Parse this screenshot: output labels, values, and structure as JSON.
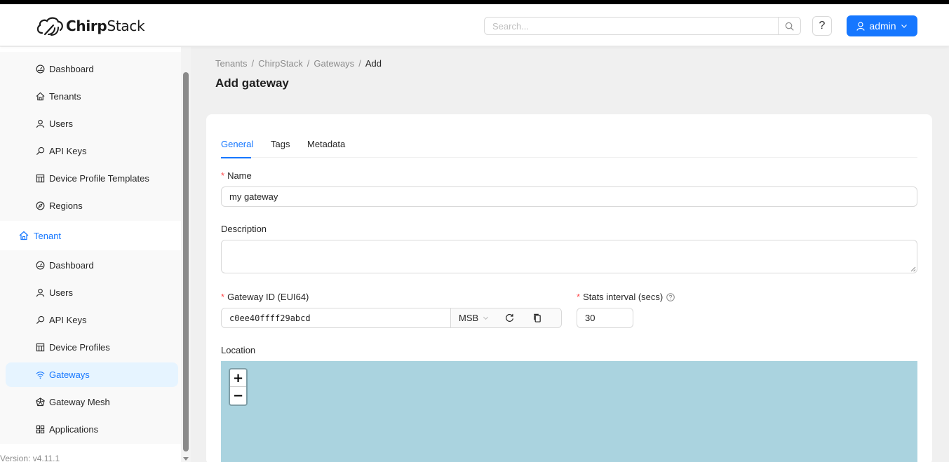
{
  "app": {
    "logo_text_bold": "Chirp",
    "logo_text_regular": "Stack"
  },
  "header": {
    "search_placeholder": "Search...",
    "help_label": "?",
    "user_label": "admin"
  },
  "sidebar": {
    "admin_items": [
      {
        "label": "Dashboard",
        "icon": "dashboard-icon"
      },
      {
        "label": "Tenants",
        "icon": "home-icon"
      },
      {
        "label": "Users",
        "icon": "user-icon"
      },
      {
        "label": "API Keys",
        "icon": "key-icon"
      },
      {
        "label": "Device Profile Templates",
        "icon": "template-icon"
      },
      {
        "label": "Regions",
        "icon": "compass-icon"
      }
    ],
    "tenant_header": "Tenant",
    "tenant_items": [
      {
        "label": "Dashboard",
        "icon": "dashboard-icon"
      },
      {
        "label": "Users",
        "icon": "user-icon"
      },
      {
        "label": "API Keys",
        "icon": "key-icon"
      },
      {
        "label": "Device Profiles",
        "icon": "template-icon"
      },
      {
        "label": "Gateways",
        "icon": "wifi-icon",
        "active": true
      },
      {
        "label": "Gateway Mesh",
        "icon": "mesh-icon"
      },
      {
        "label": "Applications",
        "icon": "apps-icon"
      }
    ],
    "version": "Version: v4.11.1"
  },
  "breadcrumb": {
    "items": [
      "Tenants",
      "ChirpStack",
      "Gateways"
    ],
    "current": "Add",
    "separator": "/"
  },
  "page": {
    "title": "Add gateway"
  },
  "tabs": [
    {
      "label": "General",
      "active": true
    },
    {
      "label": "Tags"
    },
    {
      "label": "Metadata"
    }
  ],
  "form": {
    "name_label": "Name",
    "name_value": "my gateway",
    "description_label": "Description",
    "description_value": "",
    "gateway_id_label": "Gateway ID (EUI64)",
    "gateway_id_value": "c0ee40ffff29abcd",
    "byte_order": "MSB",
    "stats_interval_label": "Stats interval (secs)",
    "stats_interval_value": "30",
    "location_label": "Location"
  },
  "map": {
    "zoom_in": "+",
    "zoom_out": "−",
    "water_color": "#aad3df"
  },
  "colors": {
    "accent": "#1677ff",
    "required": "#ff4d4f",
    "active_bg": "#e6f4ff"
  }
}
